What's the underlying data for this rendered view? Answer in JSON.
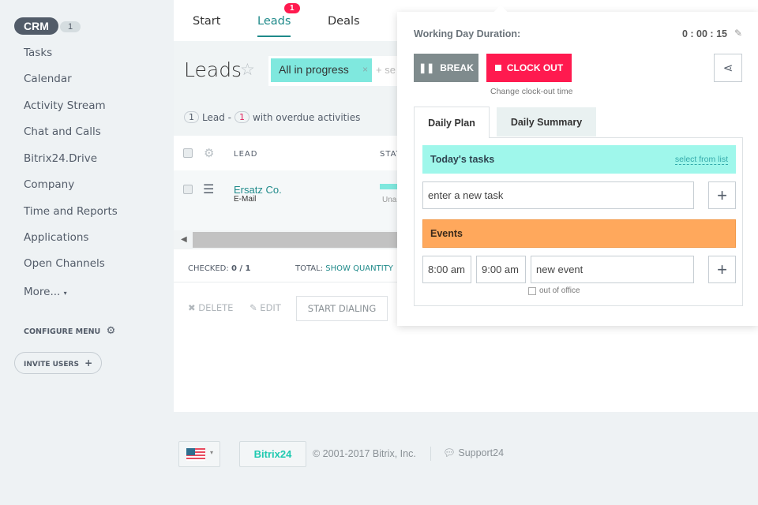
{
  "sidebar": {
    "crm_label": "CRM",
    "crm_count": "1",
    "items": [
      "Tasks",
      "Calendar",
      "Activity Stream",
      "Chat and Calls",
      "Bitrix24.Drive",
      "Company",
      "Time and Reports",
      "Applications",
      "Open Channels",
      "More..."
    ],
    "configure_menu": "CONFIGURE MENU",
    "invite_users": "INVITE USERS"
  },
  "topnav": {
    "tabs": [
      "Start",
      "Leads",
      "Deals"
    ],
    "leads_badge": "1"
  },
  "page": {
    "title": "Leads",
    "filter_chip": "All in progress",
    "search_placeholder": "+ se",
    "summary": {
      "count": "1",
      "lead_word": "Lead -",
      "overdue_count": "1",
      "overdue_text": "with overdue activities"
    }
  },
  "table": {
    "columns": [
      "LEAD",
      "STAT"
    ],
    "rows": [
      {
        "name": "Ersatz Co.",
        "sub": "E-Mail",
        "status": "Una"
      }
    ]
  },
  "list_footer": {
    "checked_label": "CHECKED:",
    "checked_value": "0 / 1",
    "total_label": "TOTAL:",
    "show_quantity": "SHOW QUANTITY"
  },
  "actions": {
    "delete": "DELETE",
    "edit": "EDIT",
    "start_dialing": "START DIALING"
  },
  "popup": {
    "duration_label": "Working Day Duration:",
    "duration_value": "0 : 00 : 15",
    "break": "BREAK",
    "clock_out": "CLOCK OUT",
    "change_time": "Change clock-out time",
    "tabs": [
      "Daily Plan",
      "Daily Summary"
    ],
    "tasks_title": "Today's tasks",
    "select_from_list": "select from list",
    "task_placeholder": "enter a new task",
    "events_title": "Events",
    "event_from": "8:00 am",
    "event_to": "9:00 am",
    "event_placeholder": "new event",
    "out_of_office": "out of office"
  },
  "footer": {
    "logo": "Bitrix24",
    "copyright": "© 2001-2017 Bitrix, Inc.",
    "support": "Support24"
  },
  "colors": {
    "accent": "#2fc6f6",
    "teal_link": "#1f8a8a",
    "red": "#ff1a4f",
    "orange": "#ffa85c",
    "cyan": "#9ff7eb",
    "grey_btn": "#7f8b8d"
  }
}
